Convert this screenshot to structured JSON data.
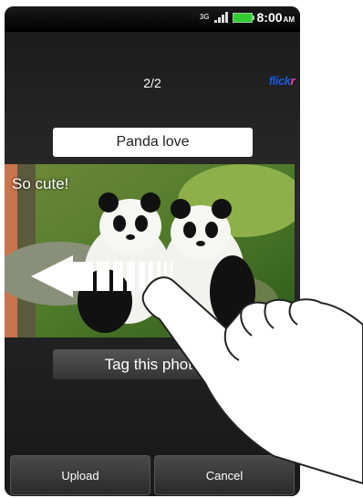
{
  "status_bar": {
    "network": "3G",
    "time": "8:00",
    "ampm": "AM"
  },
  "header": {
    "counter": "2/2",
    "logo": {
      "part1": "flick",
      "part2": "r"
    }
  },
  "title_field": {
    "value": "Panda love"
  },
  "photo": {
    "caption": "So cute!"
  },
  "tag_field": {
    "label": "Tag this photo"
  },
  "bottom_bar": {
    "upload_label": "Upload",
    "cancel_label": "Cancel"
  },
  "colors": {
    "flickr_blue": "#1a5adf",
    "flickr_pink": "#ff3ca8"
  },
  "icons": [
    "signal-icon",
    "battery-icon",
    "swipe-left-arrow-icon",
    "hand-pointer-icon"
  ]
}
